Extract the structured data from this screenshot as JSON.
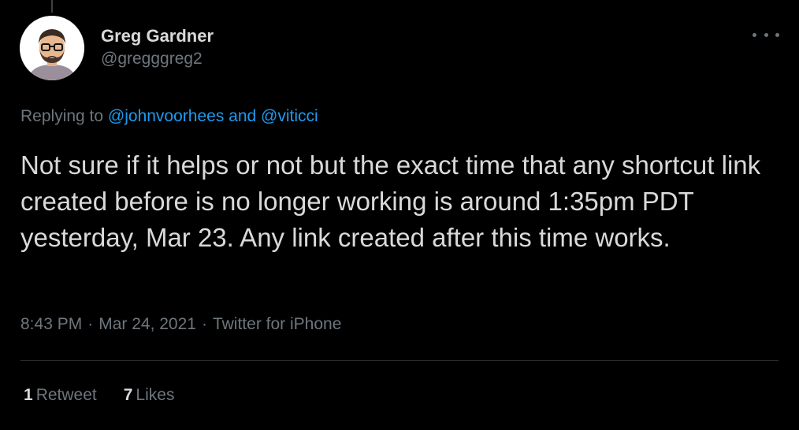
{
  "author": {
    "display_name": "Greg Gardner",
    "handle": "@gregggreg2"
  },
  "more_icon": "more-horizontal-icon",
  "reply_context": {
    "prefix": "Replying to ",
    "mentions": [
      "@johnvoorhees",
      "@viticci"
    ],
    "joiner": " and "
  },
  "tweet": {
    "text": "Not sure if it helps or not but the exact time that any shortcut link created before is no longer working is around 1:35pm PDT yesterday, Mar 23. Any link created after this time works."
  },
  "meta": {
    "time": "8:43 PM",
    "separator": "·",
    "date": "Mar 24, 2021",
    "source": "Twitter for iPhone"
  },
  "stats": {
    "retweets": {
      "count": "1",
      "label": "Retweet"
    },
    "likes": {
      "count": "7",
      "label": "Likes"
    }
  },
  "colors": {
    "background": "#000000",
    "text_primary": "#d9d9d9",
    "text_secondary": "#6e767d",
    "link": "#1d9bf0",
    "divider": "#2f3336"
  }
}
